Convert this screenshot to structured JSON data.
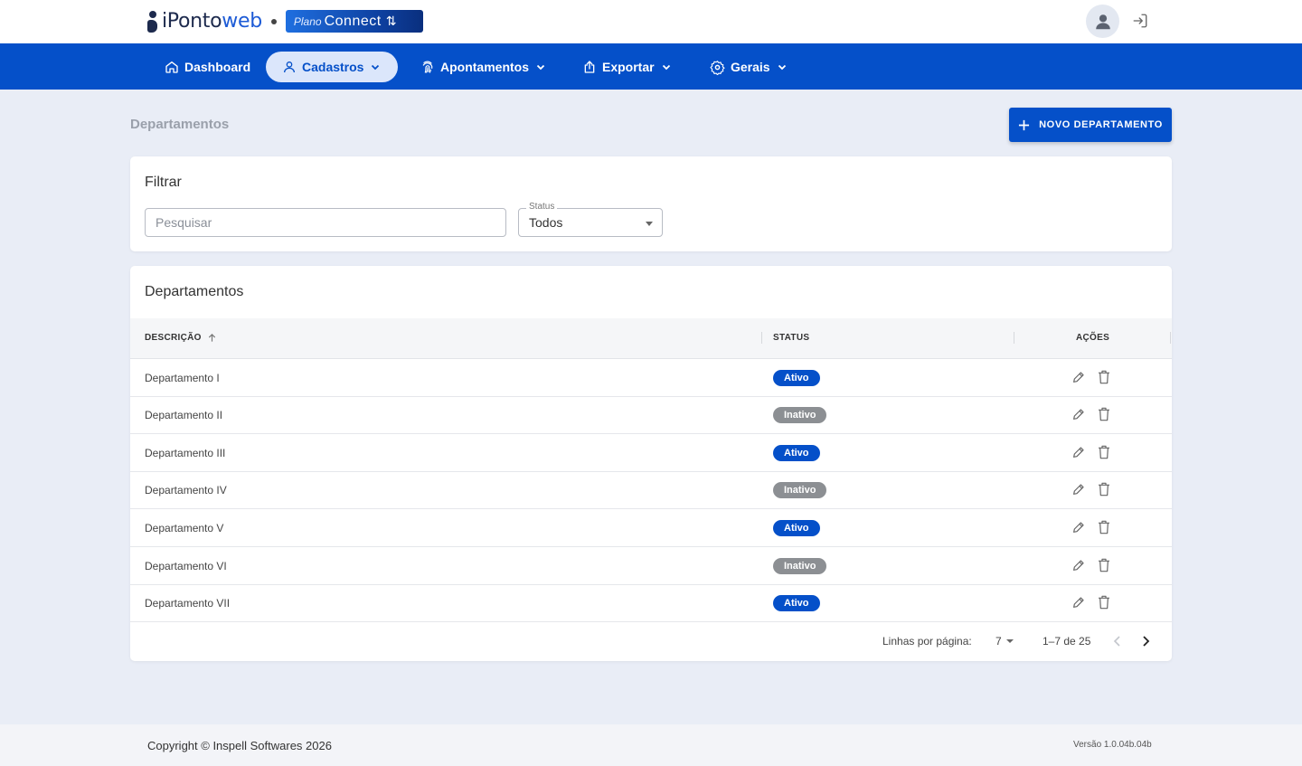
{
  "header": {
    "logo_part1": "iPonto",
    "logo_part2": "web",
    "plan_prefix": "Plano",
    "plan_name": "Connect",
    "plan_symbol": "⇅"
  },
  "nav": {
    "items": [
      {
        "label": "Dashboard",
        "icon": "home-icon",
        "has_menu": false,
        "active": false
      },
      {
        "label": "Cadastros",
        "icon": "user-icon",
        "has_menu": true,
        "active": true
      },
      {
        "label": "Apontamentos",
        "icon": "fingerprint-icon",
        "has_menu": true,
        "active": false
      },
      {
        "label": "Exportar",
        "icon": "export-icon",
        "has_menu": true,
        "active": false
      },
      {
        "label": "Gerais",
        "icon": "gear-icon",
        "has_menu": true,
        "active": false
      }
    ]
  },
  "page": {
    "title": "Departamentos",
    "new_button": "NOVO DEPARTAMENTO"
  },
  "filter": {
    "title": "Filtrar",
    "search_placeholder": "Pesquisar",
    "status_label": "Status",
    "status_value": "Todos"
  },
  "table": {
    "title": "Departamentos",
    "columns": {
      "description": "DESCRIÇÃO",
      "status": "STATUS",
      "actions": "AÇÕES"
    },
    "rows": [
      {
        "description": "Departamento I",
        "status": "Ativo"
      },
      {
        "description": "Departamento II",
        "status": "Inativo"
      },
      {
        "description": "Departamento III",
        "status": "Ativo"
      },
      {
        "description": "Departamento IV",
        "status": "Inativo"
      },
      {
        "description": "Departamento V",
        "status": "Ativo"
      },
      {
        "description": "Departamento VI",
        "status": "Inativo"
      },
      {
        "description": "Departamento VII",
        "status": "Ativo"
      }
    ],
    "pagination": {
      "rows_per_page_label": "Linhas por página:",
      "rows_per_page": "7",
      "range": "1–7 de 25"
    }
  },
  "footer": {
    "copyright": "Copyright © Inspell Softwares 2026",
    "version": "Versão 1.0.04b.04b"
  },
  "colors": {
    "primary": "#0550c9",
    "active_badge": "#0550c9",
    "inactive_badge": "#8c8f93",
    "background": "#e9edf6"
  }
}
